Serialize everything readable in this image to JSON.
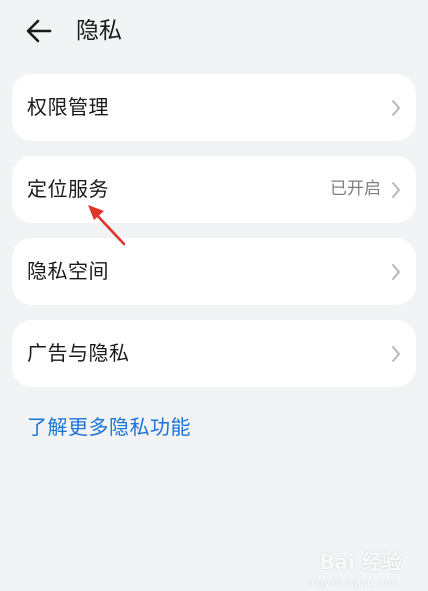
{
  "header": {
    "title": "隐私"
  },
  "menu": {
    "items": [
      {
        "label": "权限管理",
        "status": ""
      },
      {
        "label": "定位服务",
        "status": "已开启"
      },
      {
        "label": "隐私空间",
        "status": ""
      },
      {
        "label": "广告与隐私",
        "status": ""
      }
    ]
  },
  "footer": {
    "link": "了解更多隐私功能"
  },
  "watermark": {
    "main": "Bai 经验",
    "sub": "jingyan.baidu.com"
  },
  "colors": {
    "background": "#f1f3f5",
    "card": "#ffffff",
    "link": "#1a73d9",
    "annotation": "#e0352b"
  }
}
